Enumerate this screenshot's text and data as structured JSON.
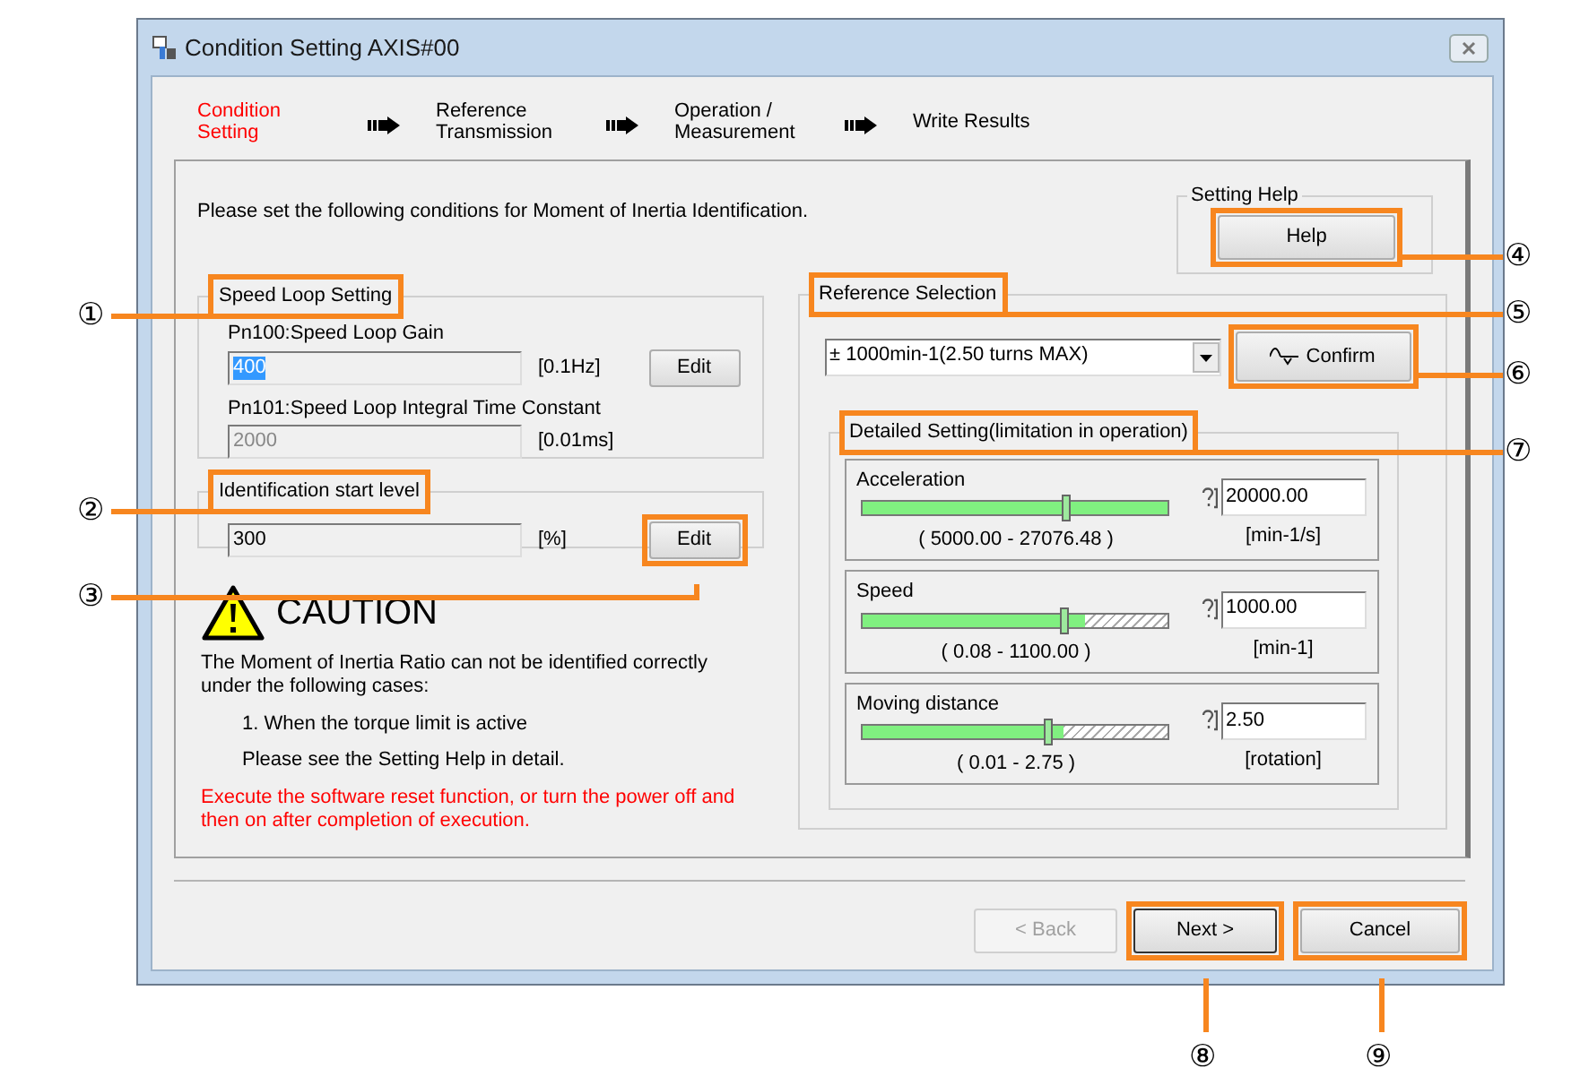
{
  "window": {
    "title": "Condition Setting AXIS#00"
  },
  "steps": [
    {
      "label": "Condition\nSetting",
      "selected": true
    },
    {
      "label": "Reference\nTransmission",
      "selected": false
    },
    {
      "label": "Operation /\nMeasurement",
      "selected": false
    },
    {
      "label": "Write Results",
      "selected": false
    }
  ],
  "intro": "Please set the following conditions for Moment of Inertia Identification.",
  "setting_help": {
    "legend": "Setting Help",
    "button": {
      "label": "Help",
      "callout": {
        "number": "④",
        "kind": "right"
      }
    }
  },
  "speed_loop_setting": {
    "legend": "Speed Loop Setting",
    "callout": {
      "number": "①",
      "kind": "left"
    },
    "params": [
      {
        "label": "Pn100:Speed Loop Gain",
        "value": "400",
        "unit": "[0.1Hz]",
        "selected": true,
        "disabled": false,
        "button": "Edit"
      },
      {
        "label": "Pn101:Speed Loop Integral Time Constant",
        "value": "2000",
        "unit": "[0.01ms]",
        "selected": false,
        "disabled": true
      }
    ]
  },
  "identification_start_level": {
    "legend": "Identification start level",
    "callout": {
      "number": "②",
      "kind": "left"
    },
    "value": "300",
    "unit": "[%]",
    "button": {
      "label": "Edit",
      "callout": {
        "number": "③",
        "kind": "elbow"
      }
    }
  },
  "caution": {
    "title": "CAUTION",
    "text": "The Moment of Inertia Ratio can not be identified correctly under the following cases:",
    "items": [
      "1. When the torque limit is active"
    ],
    "note": "Please see the Setting Help in detail.",
    "warning": "Execute the software reset function, or turn the power off and then on after completion of execution."
  },
  "reference_selection": {
    "legend": "Reference Selection",
    "callout": {
      "number": "⑤",
      "kind": "right"
    },
    "select": {
      "value": "± 1000min-1(2.50 turns MAX)"
    },
    "confirm": {
      "label": "Confirm",
      "callout": {
        "number": "⑥",
        "kind": "right"
      }
    },
    "detailed_setting": {
      "legend": "Detailed Setting(limitation in operation)",
      "callout": {
        "number": "⑦",
        "kind": "right"
      },
      "items": [
        {
          "label": "Acceleration",
          "level": 0.67,
          "allowed_range": {
            "level": 1
          },
          "value": "20000.00",
          "range": "( 5000.00 - 27076.48 )",
          "unit": "[min-1/s]"
        },
        {
          "label": "Speed",
          "level": 0.66,
          "allowed_range": {
            "level": 0.73
          },
          "value": "1000.00",
          "range": "( 0.08 - 1100.00 )",
          "unit": "[min-1]"
        },
        {
          "label": "Moving distance",
          "level": 0.61,
          "allowed_range": {
            "level": 0.66
          },
          "value": "2.50",
          "range": "( 0.01 - 2.75 )",
          "unit": "[rotation]"
        }
      ]
    }
  },
  "buttons": [
    {
      "label": "< Back",
      "disabled": true,
      "default": false
    },
    {
      "label": "Next >",
      "disabled": false,
      "default": true,
      "callout": {
        "number": "⑧",
        "kind": "below"
      }
    },
    {
      "label": "Cancel",
      "disabled": false,
      "default": false,
      "callout": {
        "number": "⑨",
        "kind": "below"
      }
    }
  ]
}
